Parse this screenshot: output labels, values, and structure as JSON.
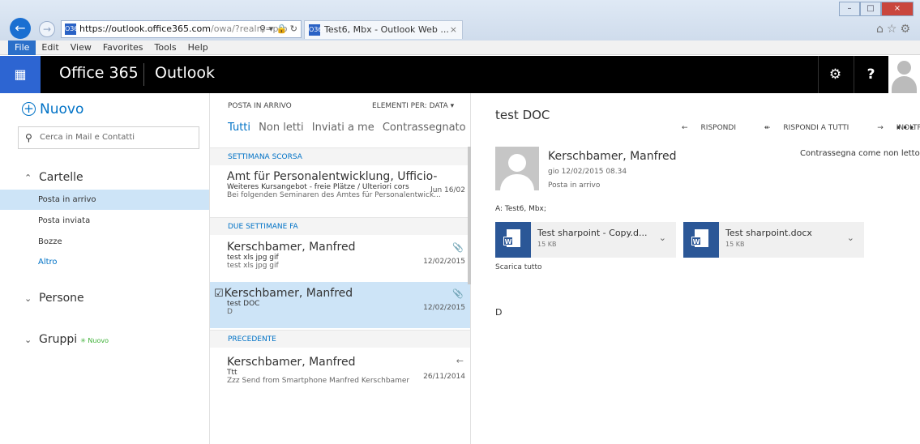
{
  "browser": {
    "url_main": "https://outlook.office365.com",
    "url_rest": "/owa/?realm=pro",
    "tab_title": "Test6, Mbx - Outlook Web ...",
    "favicon_label": "O365",
    "menu": [
      "File",
      "Edit",
      "View",
      "Favorites",
      "Tools",
      "Help"
    ]
  },
  "header": {
    "brand": "Office 365",
    "app": "Outlook"
  },
  "leftnav": {
    "new_label": "Nuovo",
    "search_placeholder": "Cerca in Mail e Contatti",
    "folders_label": "Cartelle",
    "folders": [
      "Posta in arrivo",
      "Posta inviata",
      "Bozze",
      "Altro"
    ],
    "people_label": "Persone",
    "groups_label": "Gruppi",
    "groups_badge": "Nuovo"
  },
  "msglist": {
    "title": "POSTA IN ARRIVO",
    "filter": "ELEMENTI PER: DATA",
    "tabs": [
      "Tutti",
      "Non letti",
      "Inviati a me",
      "Contrassegnato"
    ],
    "groups": [
      "SETTIMANA SCORSA",
      "DUE SETTIMANE FA",
      "PRECEDENTE"
    ],
    "messages": [
      {
        "sender": "Amt für Personalentwicklung, Ufficio-",
        "subject": "Weiteres Kursangebot - freie Plätze / Ulteriori cors",
        "date": "lun 16/02",
        "preview": "Bei folgenden Seminaren des Amtes für Personalentwick..."
      },
      {
        "sender": "Kerschbamer, Manfred",
        "subject": "test xls jpg gif",
        "date": "12/02/2015",
        "preview": "test xls jpg gif"
      },
      {
        "sender": "Kerschbamer, Manfred",
        "subject": "test DOC",
        "date": "12/02/2015",
        "preview": "D"
      },
      {
        "sender": "Kerschbamer, Manfred",
        "subject": "Ttt",
        "date": "26/11/2014",
        "preview": "Zzz Send from Smartphone Manfred Kerschbamer"
      }
    ]
  },
  "reading": {
    "subject": "test DOC",
    "actions": [
      "RISPONDI",
      "RISPONDI A TUTTI",
      "INOLTRA"
    ],
    "more": "•••",
    "from": "Kerschbamer, Manfred",
    "date": "gio 12/02/2015 08.34",
    "folder": "Posta in arrivo",
    "mark_unread": "Contrassegna come non letto",
    "to": "A: Test6, Mbx;",
    "attachments": [
      {
        "name": "Test sharpoint - Copy.d...",
        "size": "15 KB"
      },
      {
        "name": "Test sharpoint.docx",
        "size": "15 KB"
      }
    ],
    "download_all": "Scarica tutto",
    "body": "D"
  }
}
